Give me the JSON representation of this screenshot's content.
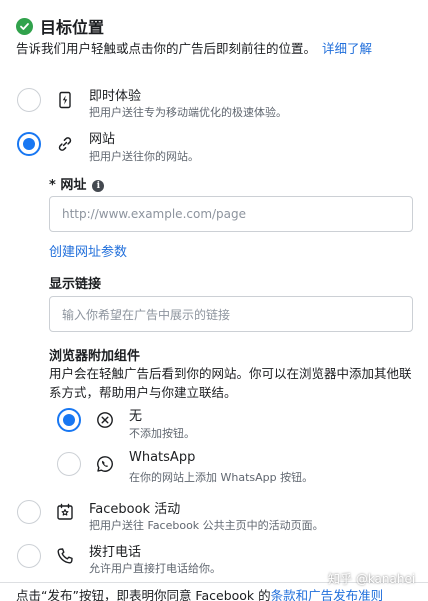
{
  "header": {
    "title": "目标位置",
    "subtitle": "告诉我们用户轻触或点击你的广告后即刻前往的位置。",
    "learn_more": "详细了解"
  },
  "destinations": [
    {
      "title": "即时体验",
      "description": "把用户送往专为移动端优化的极速体验。",
      "selected": false,
      "icon": "instant-experience-icon"
    },
    {
      "title": "网站",
      "description": "把用户送往你的网站。",
      "selected": true,
      "icon": "link-icon"
    }
  ],
  "website": {
    "url_label": "网址",
    "required_mark": "* ",
    "url_placeholder": "http://www.example.com/page",
    "build_params_link": "创建网址参数",
    "display_link_label": "显示链接",
    "display_link_placeholder": "输入你希望在广告中展示的链接"
  },
  "browser_addon": {
    "title": "浏览器附加组件",
    "description": "用户会在轻触广告后看到你的网站。你可以在浏览器中添加其他联系方式，帮助用户与你建立联结。",
    "options": [
      {
        "title": "无",
        "description": "不添加按钮。",
        "selected": true,
        "icon": "circle-x-icon"
      },
      {
        "title": "WhatsApp",
        "description": "在你的网站上添加 WhatsApp 按钮。",
        "selected": false,
        "icon": "whatsapp-icon"
      }
    ]
  },
  "more_destinations": [
    {
      "title": "Facebook 活动",
      "description": "把用户送往 Facebook 公共主页中的活动页面。",
      "selected": false,
      "icon": "event-star-icon"
    },
    {
      "title": "拨打电话",
      "description": "允许用户直接打电话给你。",
      "selected": false,
      "icon": "phone-icon"
    }
  ],
  "footer": {
    "text_prefix": "点击“发布”按钮，即表明你同意 Facebook 的",
    "terms_link": "条款和广告发布准则"
  },
  "watermark": "知乎 @kanahei",
  "colors": {
    "accent": "#1877f2",
    "link": "#216fdb",
    "success": "#31a24c"
  }
}
